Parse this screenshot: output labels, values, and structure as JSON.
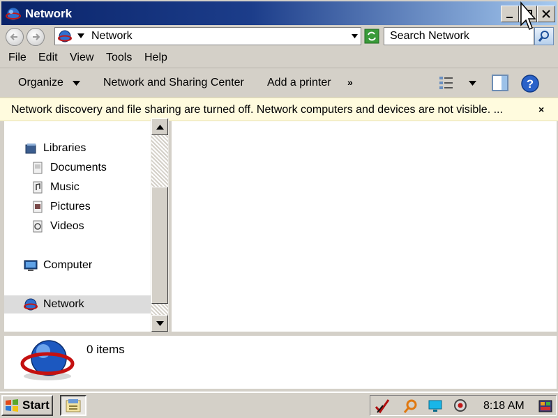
{
  "window": {
    "title": "Network"
  },
  "address": {
    "location": "Network",
    "search_placeholder": "Search Network"
  },
  "menu": [
    "File",
    "Edit",
    "View",
    "Tools",
    "Help"
  ],
  "commands": {
    "organize": "Organize",
    "network_center": "Network and Sharing Center",
    "add_printer": "Add a printer",
    "more": "»"
  },
  "infobar": {
    "message": "Network discovery and file sharing are turned off. Network computers and devices are not visible. ...",
    "close": "×"
  },
  "nav": {
    "libraries": "Libraries",
    "documents": "Documents",
    "music": "Music",
    "pictures": "Pictures",
    "videos": "Videos",
    "computer": "Computer",
    "network": "Network"
  },
  "details": {
    "count": "0 items"
  },
  "taskbar": {
    "start": "Start",
    "clock": "8:18 AM"
  },
  "colors": {
    "title_start": "#0a246a",
    "title_end": "#a6caf0",
    "infobar": "#fffbde",
    "chrome": "#d4d0c8",
    "selected": "#dcdcdc"
  },
  "icons": [
    "network-globe-icon",
    "back-icon",
    "forward-icon",
    "refresh-icon",
    "search-icon",
    "library-icon",
    "document-icon",
    "music-icon",
    "pictures-icon",
    "videos-icon",
    "computer-icon",
    "view-icon",
    "preview-pane-icon",
    "help-icon",
    "windows-logo-icon"
  ]
}
